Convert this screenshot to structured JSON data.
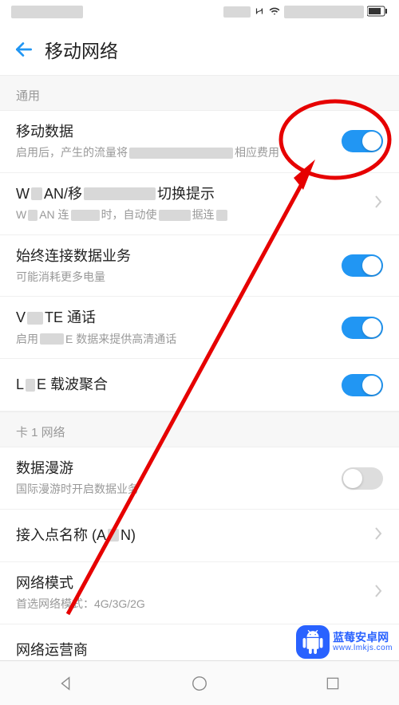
{
  "statusbar": {
    "wifi_icon": "wifi"
  },
  "header": {
    "title": "移动网络"
  },
  "sections": {
    "general_label": "通用",
    "sim1_label": "卡 1 网络"
  },
  "rows": {
    "mobile_data": {
      "title": "移动数据",
      "sub_prefix": "启用后，产生的流量将",
      "sub_suffix": "相应费用",
      "on": true
    },
    "wlan_switch": {
      "title_p1": "W",
      "title_p2": "AN/移",
      "title_p3": "切换提示",
      "sub_p1": "W",
      "sub_p2": "AN 连",
      "sub_p3": "时，自动使",
      "sub_p4": "据连"
    },
    "always_data": {
      "title": "始终连接数据业务",
      "sub": "可能消耗更多电量",
      "on": true
    },
    "volte": {
      "title_p1": "V",
      "title_p2": "TE 通话",
      "sub_p1": "启用",
      "sub_p2": "E 数据来提供高清通话",
      "on": true
    },
    "lte_ca": {
      "title_p1": "L",
      "title_p2": "E 载波聚合",
      "on": true
    },
    "roaming": {
      "title": "数据漫游",
      "sub": "国际漫游时开启数据业务",
      "on": false
    },
    "apn": {
      "title_p1": "接入点名称 (A",
      "title_p2": "N)"
    },
    "net_mode": {
      "title": "网络模式",
      "sub": "首选网络模式：4G/3G/2G"
    },
    "operator": {
      "title": "网络运营商"
    }
  },
  "watermark": {
    "title": "蓝莓安卓网",
    "url": "www.lmkjs.com"
  }
}
